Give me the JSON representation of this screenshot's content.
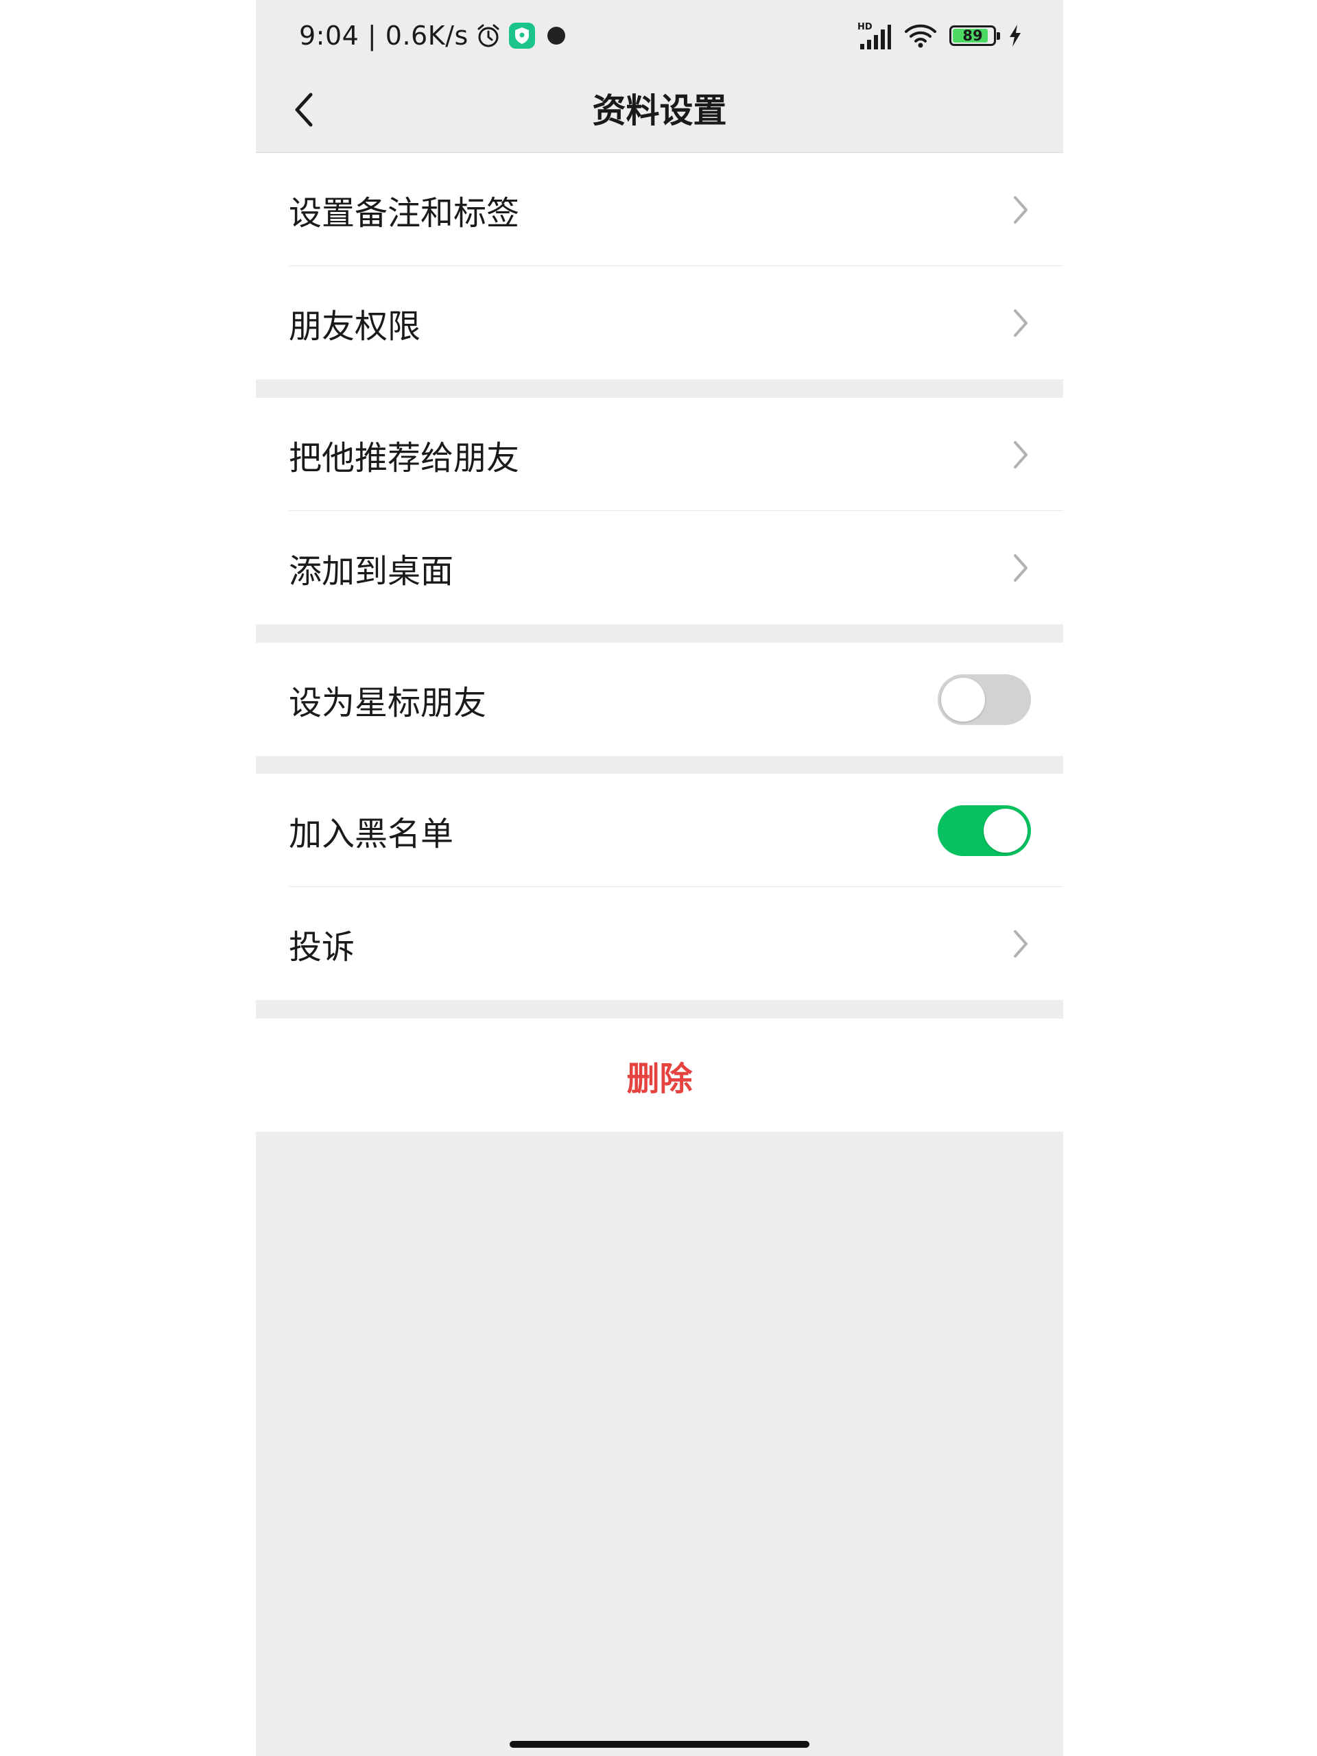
{
  "status_bar": {
    "time_speed": "9:04 | 0.6K/s",
    "network_badge": "HD",
    "battery": "89",
    "battery_level": 0.89,
    "icons": [
      "alarm-icon",
      "shield-app-icon",
      "record-dot-icon",
      "signal-icon",
      "wifi-icon",
      "battery-icon",
      "charging-icon"
    ]
  },
  "header": {
    "title": "资料设置",
    "back_icon": "chevron-left-icon"
  },
  "groups": [
    {
      "items": [
        {
          "label": "设置备注和标签",
          "control": "chevron"
        },
        {
          "label": "朋友权限",
          "control": "chevron"
        }
      ]
    },
    {
      "items": [
        {
          "label": "把他推荐给朋友",
          "control": "chevron"
        },
        {
          "label": "添加到桌面",
          "control": "chevron"
        }
      ]
    },
    {
      "items": [
        {
          "label": "设为星标朋友",
          "control": "toggle",
          "on": false
        }
      ]
    },
    {
      "items": [
        {
          "label": "加入黑名单",
          "control": "toggle",
          "on": true
        },
        {
          "label": "投诉",
          "control": "chevron"
        }
      ]
    }
  ],
  "delete_label": "删除",
  "colors": {
    "accent_green": "#07c160",
    "danger_red": "#e64340",
    "background": "#ededed",
    "toggle_off": "#d2d2d2"
  }
}
